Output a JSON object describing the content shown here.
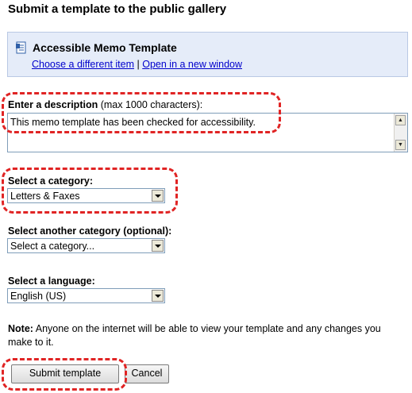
{
  "page": {
    "title": "Submit a template to the public gallery"
  },
  "item": {
    "name": "Accessible Memo Template",
    "icon": "document-icon",
    "choose_link": "Choose a different item",
    "separator": "|",
    "open_link": "Open in a new window"
  },
  "description": {
    "label": "Enter a description",
    "hint": "(max 1000 characters):",
    "value": "This memo template has been checked for accessibility."
  },
  "category": {
    "label": "Select a category:",
    "value": "Letters & Faxes"
  },
  "another_category": {
    "label": "Select another category (optional):",
    "value": "Select a category..."
  },
  "language": {
    "label": "Select a language:",
    "value": "English (US)"
  },
  "note": {
    "prefix": "Note:",
    "text": " Anyone on the internet will be able to view your template and any changes you make to it."
  },
  "buttons": {
    "submit": "Submit template",
    "cancel": "Cancel"
  },
  "colors": {
    "highlight": "#e02424",
    "link": "#0000cc",
    "info_box": "#e5ecf9"
  }
}
